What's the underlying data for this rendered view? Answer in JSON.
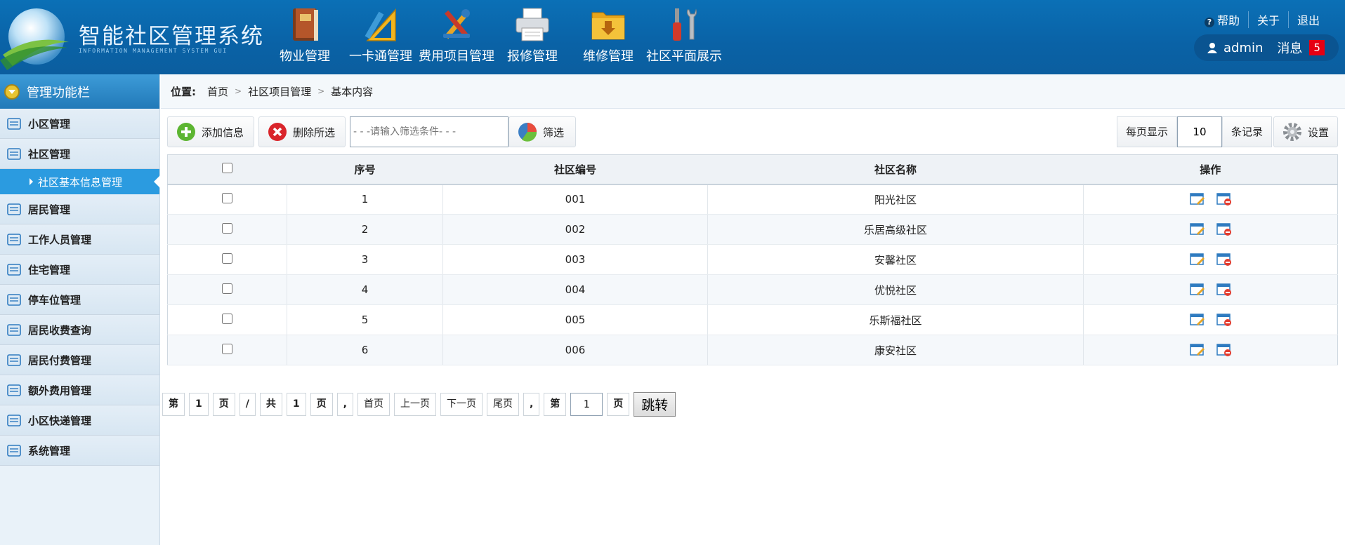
{
  "app": {
    "title": "智能社区管理系统",
    "subtitle": "INFORMATION MANAGEMENT SYSTEM GUI"
  },
  "topnav": [
    {
      "label": "物业管理",
      "icon": "book-icon"
    },
    {
      "label": "一卡通管理",
      "icon": "ruler-pencil-icon"
    },
    {
      "label": "费用项目管理",
      "icon": "tools-cross-icon"
    },
    {
      "label": "报修管理",
      "icon": "printer-icon"
    },
    {
      "label": "维修管理",
      "icon": "folder-download-icon"
    },
    {
      "label": "社区平面展示",
      "icon": "screwdriver-wrench-icon"
    }
  ],
  "toplinks": {
    "help": "帮助",
    "about": "关于",
    "logout": "退出"
  },
  "user": {
    "name": "admin",
    "messages_label": "消息",
    "message_count": "5"
  },
  "sidebar": {
    "title": "管理功能栏",
    "items": [
      {
        "label": "小区管理"
      },
      {
        "label": "社区管理"
      },
      {
        "label": "居民管理"
      },
      {
        "label": "工作人员管理"
      },
      {
        "label": "住宅管理"
      },
      {
        "label": "停车位管理"
      },
      {
        "label": "居民收费查询"
      },
      {
        "label": "居民付费管理"
      },
      {
        "label": "额外费用管理"
      },
      {
        "label": "小区快递管理"
      },
      {
        "label": "系统管理"
      }
    ],
    "active_sub": "社区基本信息管理"
  },
  "breadcrumb": {
    "label": "位置:",
    "items": [
      "首页",
      "社区项目管理",
      "基本内容"
    ]
  },
  "toolbar": {
    "add_label": "添加信息",
    "delete_label": "删除所选",
    "search_placeholder": "- - -请输入筛选条件- - -",
    "filter_label": "筛选",
    "per_page_label": "每页显示",
    "per_page_value": "10",
    "records_label": "条记录",
    "settings_label": "设置"
  },
  "table": {
    "headers": [
      "序号",
      "社区编号",
      "社区名称",
      "操作"
    ],
    "rows": [
      {
        "no": "1",
        "code": "001",
        "name": "阳光社区"
      },
      {
        "no": "2",
        "code": "002",
        "name": "乐居高级社区"
      },
      {
        "no": "3",
        "code": "003",
        "name": "安馨社区"
      },
      {
        "no": "4",
        "code": "004",
        "name": "优悦社区"
      },
      {
        "no": "5",
        "code": "005",
        "name": "乐斯福社区"
      },
      {
        "no": "6",
        "code": "006",
        "name": "康安社区"
      }
    ]
  },
  "pager": {
    "di": "第",
    "current": "1",
    "ye": "页",
    "slash": "/",
    "gong": "共",
    "total": "1",
    "ye2": "页",
    "comma": ",",
    "first": "首页",
    "prev": "上一页",
    "next": "下一页",
    "last": "尾页",
    "comma2": ",",
    "di2": "第",
    "jump_value": "1",
    "ye3": "页",
    "go": "跳转"
  },
  "colors": {
    "header": "#0a62a6",
    "sidebar_active": "#2b9be0",
    "badge": "#e60012"
  }
}
